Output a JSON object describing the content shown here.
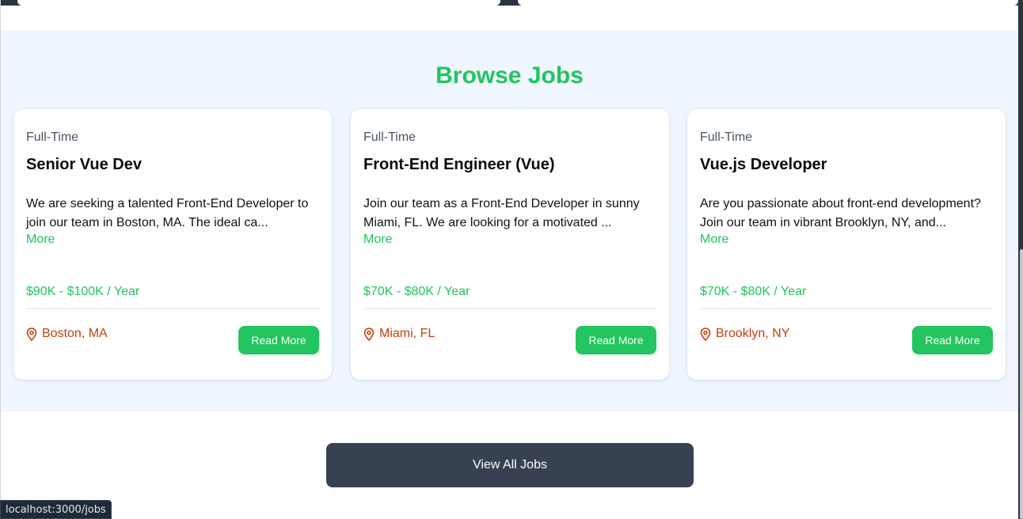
{
  "section": {
    "title": "Browse Jobs"
  },
  "jobs": [
    {
      "type": "Full-Time",
      "title": "Senior Vue Dev",
      "description": "We are seeking a talented Front-End Developer to join our team in Boston, MA. The ideal ca...",
      "more_label": "More",
      "salary": "$90K - $100K / Year",
      "location": "Boston, MA",
      "read_more_label": "Read More"
    },
    {
      "type": "Full-Time",
      "title": "Front-End Engineer (Vue)",
      "description": "Join our team as a Front-End Developer in sunny Miami, FL. We are looking for a motivated ...",
      "more_label": "More",
      "salary": "$70K - $80K / Year",
      "location": "Miami, FL",
      "read_more_label": "Read More"
    },
    {
      "type": "Full-Time",
      "title": "Vue.js Developer",
      "description": "Are you passionate about front-end development? Join our team in vibrant Brooklyn, NY, and...",
      "more_label": "More",
      "salary": "$70K - $80K / Year",
      "location": "Brooklyn, NY",
      "read_more_label": "Read More"
    }
  ],
  "view_all_label": "View All Jobs",
  "status_bar": {
    "url": "localhost:3000/jobs"
  },
  "icons": {
    "location": "map-pin-icon"
  },
  "colors": {
    "accent": "#22c55e",
    "location": "#c2410c",
    "section_bg": "#eff6ff",
    "view_all_bg": "#374151"
  }
}
